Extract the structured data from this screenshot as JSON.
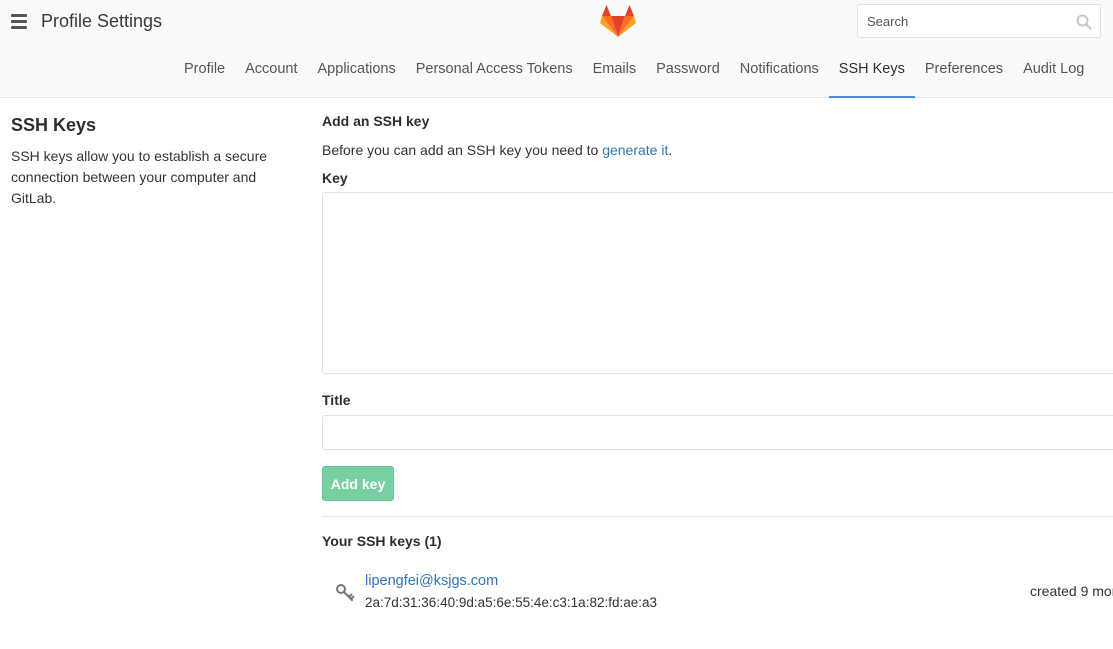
{
  "header": {
    "title": "Profile Settings",
    "search_placeholder": "Search"
  },
  "tabs": [
    {
      "label": "Profile"
    },
    {
      "label": "Account"
    },
    {
      "label": "Applications"
    },
    {
      "label": "Personal Access Tokens"
    },
    {
      "label": "Emails"
    },
    {
      "label": "Password"
    },
    {
      "label": "Notifications"
    },
    {
      "label": "SSH Keys",
      "active": true
    },
    {
      "label": "Preferences"
    },
    {
      "label": "Audit Log"
    }
  ],
  "sidebar": {
    "heading": "SSH Keys",
    "description": "SSH keys allow you to establish a secure connection between your computer and GitLab."
  },
  "form": {
    "heading": "Add an SSH key",
    "intro_text": "Before you can add an SSH key you need to ",
    "intro_link": "generate it",
    "intro_end": ".",
    "key_label": "Key",
    "key_value": "",
    "title_label": "Title",
    "title_value": "",
    "add_button": "Add key"
  },
  "keys_list": {
    "heading": "Your SSH keys (1)",
    "items": [
      {
        "title": "lipengfei@ksjgs.com",
        "fingerprint": "2a:7d:31:36:40:9d:a5:6e:55:4e:c3:1a:82:fd:ae:a3",
        "created": "created 9 mon"
      }
    ]
  },
  "colors": {
    "accent": "#4a8bd2",
    "link": "#2e75b6",
    "button_bg": "#78cfa1",
    "logo_orange": "#fc6d26",
    "logo_red": "#e24329",
    "logo_light": "#fca326"
  },
  "icons": {
    "menu": "hamburger-icon",
    "logo": "gitlab-tanuki-logo",
    "search": "search-icon",
    "key": "key-icon"
  }
}
